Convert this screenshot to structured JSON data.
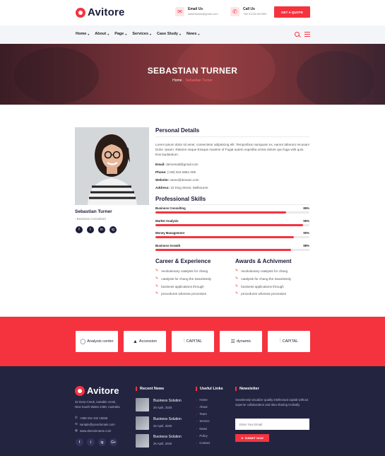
{
  "brand": {
    "name": "Avitore",
    "accent": "#f5333f",
    "dark": "#1b1c3a",
    "footer_bg": "#232540"
  },
  "header": {
    "email": {
      "icon": "mail-icon",
      "title": "Email Us",
      "value": "webinfomia@gmail.com"
    },
    "call": {
      "icon": "phone-icon",
      "title": "Call Us",
      "value": "+86 01234 567890"
    },
    "quote_button": "GET A QUOTE"
  },
  "nav": {
    "items": [
      "Home",
      "About",
      "Page",
      "Services",
      "Case Study",
      "News"
    ]
  },
  "banner": {
    "title": "SEBASTIAN TURNER",
    "crumb_home": "Home",
    "crumb_sep": "/",
    "crumb_current": "Sebastian Turner"
  },
  "profile": {
    "name": "Sebastian Turner",
    "role": "- Business Consultant",
    "socials": [
      "f",
      "t",
      "in",
      "ig"
    ]
  },
  "personal": {
    "heading": "Personal Details",
    "paragraph": "Lorem ipsum dolor sit amet, consectetur adipisicing elit. Temporibus numquam ex, earum laborum recusan! Dolor. Ipsam. Ratione neque Eosque maxime of Fugat autem expedita omnis dolore quo fuga velit quis. Eos laudantium.",
    "email_label": "Email:",
    "email": "demomail@gmail.com",
    "phone_label": "Phone:",
    "phone": "(+80) 944 5981 005",
    "website_label": "Website:",
    "website": "name@domain.com",
    "address_label": "Address:",
    "address": "10 King Street, Melbourne"
  },
  "skills": {
    "heading": "Professional Skills",
    "items": [
      {
        "label": "Business Consulting",
        "value": 85,
        "text": "85%"
      },
      {
        "label": "Market Analysis",
        "value": 96,
        "text": "96%"
      },
      {
        "label": "Money Management",
        "value": 90,
        "text": "90%"
      },
      {
        "label": "Business Growth",
        "value": 88,
        "text": "88%"
      }
    ]
  },
  "career": {
    "heading": "Career & Experience",
    "items": [
      "revolutionary catalysts for chang",
      "catalysts for chang the Seamlessly",
      "business applications through",
      "procedures whereas processes"
    ]
  },
  "awards": {
    "heading": "Awards & Achivment",
    "items": [
      "revolutionary catalysts for chang",
      "catalysts for chang the Seamlessly",
      "business applications through",
      "procedures whereas processes"
    ]
  },
  "partners": [
    {
      "icon": "circle-logo-icon",
      "name": "Analysis center"
    },
    {
      "icon": "triangle-logo-icon",
      "name": "Accession"
    },
    {
      "icon": "capital-logo-icon",
      "name": "CAPITAL"
    },
    {
      "icon": "dynamic-logo-icon",
      "name": "dynamic"
    },
    {
      "icon": "capital-logo-icon",
      "name": "CAPITAL"
    }
  ],
  "footer": {
    "address_line1": "32 Dora Creek, tuntable creek,",
    "address_line2": "New South Wales 2480, Australia",
    "phone": "+088 234 432 15565",
    "email": "sample@yourdomain.com",
    "website": "www.demoinname.com",
    "socials": [
      "f",
      "t",
      "ig",
      "G+"
    ],
    "news_heading": "Recent News",
    "news": [
      {
        "title": "Business Solution",
        "date": "26 April, 2020"
      },
      {
        "title": "Business Solution",
        "date": "26 April, 2020"
      },
      {
        "title": "Business Solution",
        "date": "26 April, 2020"
      }
    ],
    "links_heading": "Useful Links",
    "links": [
      "Home",
      "About",
      "Team",
      "Service",
      "News",
      "Policy",
      "Contact"
    ],
    "newsletter_heading": "Newsletter",
    "newsletter_text": "Seamlessly visualize quality intellectual capital without superior collaboration and idea sharing Holisally",
    "newsletter_placeholder": "Enter Your Email",
    "newsletter_button": "SUBMIT NOW"
  }
}
